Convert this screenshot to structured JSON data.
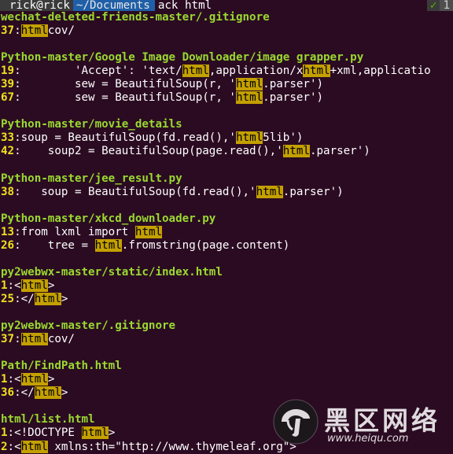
{
  "prompt": {
    "user_host": "rick@rick",
    "cwd": "~/Documents",
    "command": "ack html",
    "status_ok": "✓",
    "status_num": "1"
  },
  "colors": {
    "background": "#2b0b22",
    "filename": "#9ad930",
    "line_number": "#f0e020",
    "match_highlight": "#c4a000"
  },
  "results": [
    {
      "file": "wechat-deleted-friends-master/.gitignore",
      "lines": [
        {
          "n": "37",
          "sep": ":",
          "parts": [
            {
              "t": ""
            },
            {
              "t": "html",
              "m": true
            },
            {
              "t": "cov/"
            }
          ]
        }
      ]
    },
    {
      "file": "Python-master/Google Image Downloader/image grapper.py",
      "lines": [
        {
          "n": "19",
          "sep": ":",
          "parts": [
            {
              "t": "        'Accept': 'text/"
            },
            {
              "t": "html",
              "m": true
            },
            {
              "t": ",application/x"
            },
            {
              "t": "html",
              "m": true
            },
            {
              "t": "+xml,applicatio"
            }
          ]
        },
        {
          "n": "39",
          "sep": ":",
          "parts": [
            {
              "t": "        sew = BeautifulSoup(r, '"
            },
            {
              "t": "html",
              "m": true
            },
            {
              "t": ".parser')"
            }
          ]
        },
        {
          "n": "67",
          "sep": ":",
          "parts": [
            {
              "t": "        sew = BeautifulSoup(r, '"
            },
            {
              "t": "html",
              "m": true
            },
            {
              "t": ".parser')"
            }
          ]
        }
      ]
    },
    {
      "file": "Python-master/movie_details",
      "lines": [
        {
          "n": "33",
          "sep": ":",
          "parts": [
            {
              "t": "soup = BeautifulSoup(fd.read(),'"
            },
            {
              "t": "html",
              "m": true
            },
            {
              "t": "5lib')"
            }
          ]
        },
        {
          "n": "42",
          "sep": ":",
          "parts": [
            {
              "t": "    soup2 = BeautifulSoup(page.read(),'"
            },
            {
              "t": "html",
              "m": true
            },
            {
              "t": ".parser')"
            }
          ]
        }
      ]
    },
    {
      "file": "Python-master/jee_result.py",
      "lines": [
        {
          "n": "38",
          "sep": ":",
          "parts": [
            {
              "t": "   soup = BeautifulSoup(fd.read(),'"
            },
            {
              "t": "html",
              "m": true
            },
            {
              "t": ".parser')"
            }
          ]
        }
      ]
    },
    {
      "file": "Python-master/xkcd_downloader.py",
      "lines": [
        {
          "n": "13",
          "sep": ":",
          "parts": [
            {
              "t": "from lxml import "
            },
            {
              "t": "html",
              "m": true
            },
            {
              "t": ""
            }
          ]
        },
        {
          "n": "26",
          "sep": ":",
          "parts": [
            {
              "t": "    tree = "
            },
            {
              "t": "html",
              "m": true
            },
            {
              "t": ".fromstring(page.content)"
            }
          ]
        }
      ]
    },
    {
      "file": "py2webwx-master/static/index.html",
      "lines": [
        {
          "n": "1",
          "sep": ":",
          "parts": [
            {
              "t": "<"
            },
            {
              "t": "html",
              "m": true
            },
            {
              "t": ">"
            }
          ]
        },
        {
          "n": "25",
          "sep": ":",
          "parts": [
            {
              "t": "</"
            },
            {
              "t": "html",
              "m": true
            },
            {
              "t": ">"
            }
          ]
        }
      ]
    },
    {
      "file": "py2webwx-master/.gitignore",
      "lines": [
        {
          "n": "37",
          "sep": ":",
          "parts": [
            {
              "t": ""
            },
            {
              "t": "html",
              "m": true
            },
            {
              "t": "cov/"
            }
          ]
        }
      ]
    },
    {
      "file": "Path/FindPath.html",
      "lines": [
        {
          "n": "1",
          "sep": ":",
          "parts": [
            {
              "t": "<"
            },
            {
              "t": "html",
              "m": true
            },
            {
              "t": ">"
            }
          ]
        },
        {
          "n": "36",
          "sep": ":",
          "parts": [
            {
              "t": "</"
            },
            {
              "t": "html",
              "m": true
            },
            {
              "t": ">"
            }
          ]
        }
      ]
    },
    {
      "file": "html/list.html",
      "lines": [
        {
          "n": "1",
          "sep": ":",
          "parts": [
            {
              "t": "<!DOCTYPE "
            },
            {
              "t": "html",
              "m": true
            },
            {
              "t": ">"
            }
          ]
        },
        {
          "n": "2",
          "sep": ":",
          "parts": [
            {
              "t": "<"
            },
            {
              "t": "html",
              "m": true
            },
            {
              "t": " xmlns:th=\"http://www.thymeleaf.org\">"
            }
          ]
        }
      ]
    }
  ],
  "watermark": {
    "text": "黑区网络",
    "url": "www.heiqu.com"
  }
}
